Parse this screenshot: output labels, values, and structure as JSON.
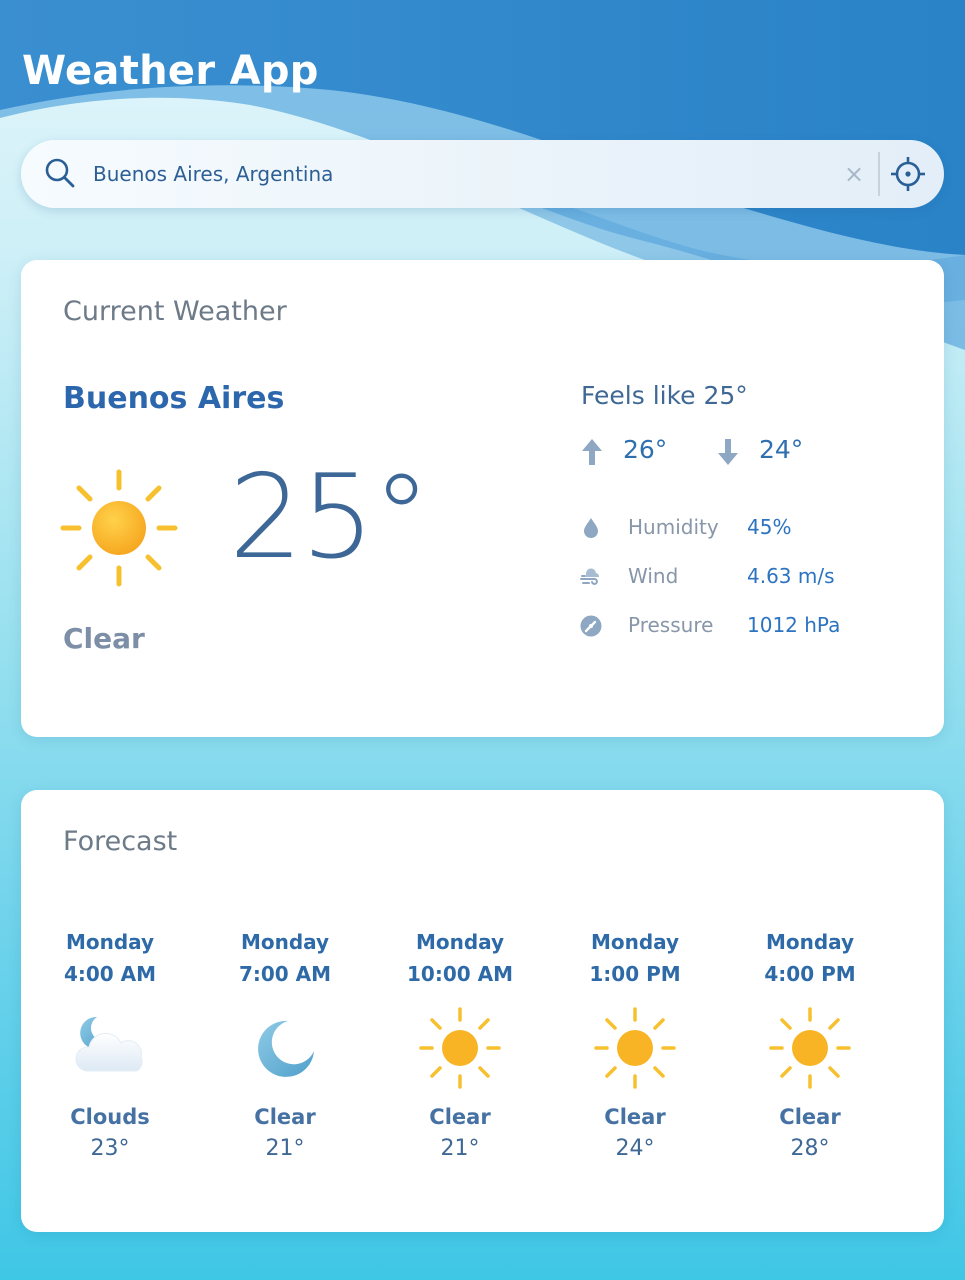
{
  "app": {
    "title": "Weather App"
  },
  "search": {
    "value": "Buenos Aires, Argentina",
    "clear_label": "×"
  },
  "current": {
    "heading": "Current Weather",
    "city": "Buenos Aires",
    "temperature": "25°",
    "condition": "Clear",
    "condition_icon": "sun-icon",
    "feels_like": "Feels like 25°",
    "high": "26°",
    "low": "24°",
    "details": [
      {
        "icon": "humidity-drop-icon",
        "label": "Humidity",
        "value": "45%"
      },
      {
        "icon": "wind-icon",
        "label": "Wind",
        "value": "4.63 m/s"
      },
      {
        "icon": "pressure-gauge-icon",
        "label": "Pressure",
        "value": "1012 hPa"
      }
    ]
  },
  "forecast": {
    "heading": "Forecast",
    "items": [
      {
        "day": "Monday",
        "time": "4:00 AM",
        "icon": "cloud-moon-icon",
        "condition": "Clouds",
        "temp": "23°"
      },
      {
        "day": "Monday",
        "time": "7:00 AM",
        "icon": "moon-icon",
        "condition": "Clear",
        "temp": "21°"
      },
      {
        "day": "Monday",
        "time": "10:00 AM",
        "icon": "sun-icon",
        "condition": "Clear",
        "temp": "21°"
      },
      {
        "day": "Monday",
        "time": "1:00 PM",
        "icon": "sun-icon",
        "condition": "Clear",
        "temp": "24°"
      },
      {
        "day": "Monday",
        "time": "4:00 PM",
        "icon": "sun-icon",
        "condition": "Clear",
        "temp": "28°"
      }
    ]
  },
  "colors": {
    "header_blue": "#2a86c8",
    "accent_blue": "#2c73c0",
    "sun_yellow": "#f7b92a"
  }
}
